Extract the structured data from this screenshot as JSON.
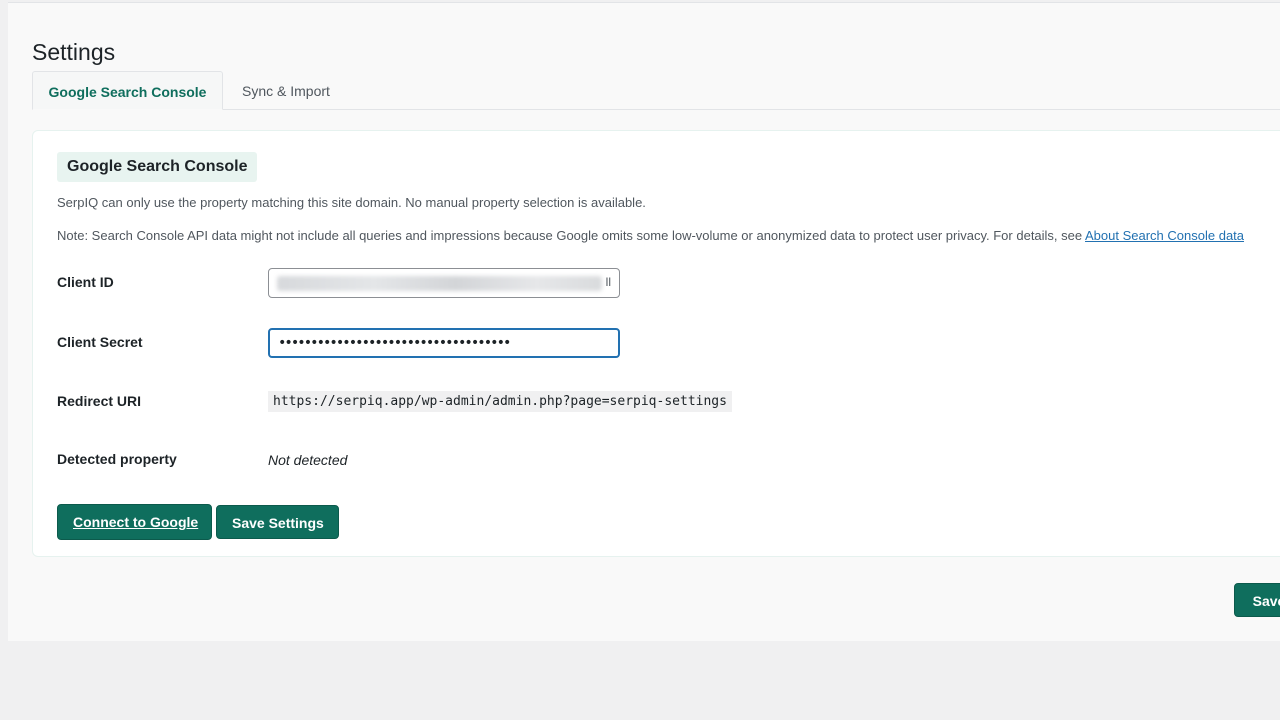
{
  "page": {
    "title": "Settings"
  },
  "tabs": [
    {
      "label": "Google Search Console",
      "active": true
    },
    {
      "label": "Sync & Import",
      "active": false
    }
  ],
  "section": {
    "heading": "Google Search Console",
    "description": "SerpIQ can only use the property matching this site domain. No manual property selection is available.",
    "note_text": "Note: Search Console API data might not include all queries and impressions because Google omits some low-volume or anonymized data to protect user privacy. For details, see ",
    "note_link": "About Search Console data"
  },
  "fields": {
    "client_id": {
      "label": "Client ID",
      "visible_tail": "ll"
    },
    "client_secret": {
      "label": "Client Secret",
      "value": "••••••••••••••••••••••••••••••••••••"
    },
    "redirect_uri": {
      "label": "Redirect URI",
      "value": "https://serpiq.app/wp-admin/admin.php?page=serpiq-settings"
    },
    "detected_property": {
      "label": "Detected property",
      "value": "Not detected"
    }
  },
  "buttons": {
    "connect": "Connect to Google",
    "save_settings": "Save Settings",
    "save_bottom": "Save"
  },
  "colors": {
    "primary": "#0f6e5d",
    "link": "#2271b1",
    "focus_border": "#2271b1",
    "heading_bg": "#e8f4f0"
  }
}
